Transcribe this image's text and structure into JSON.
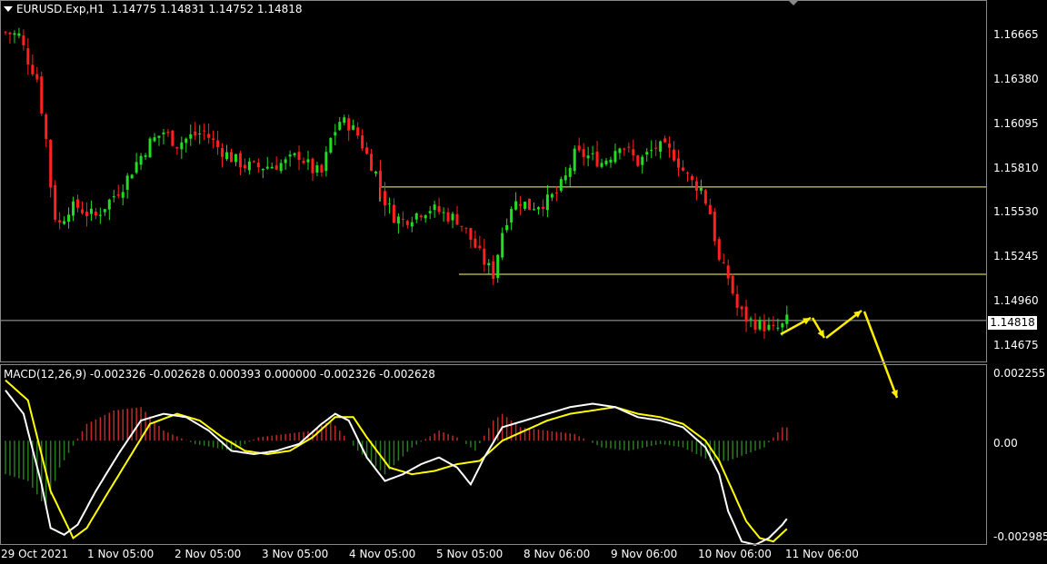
{
  "header": {
    "symbol": "EURUSD.Exp,H1",
    "ohlc": "1.14775 1.14831 1.14752 1.14818"
  },
  "macd": {
    "title": "MACD(12,26,9) -0.002326 -0.002628 0.000393 0.000000 -0.002326 -0.002628"
  },
  "price_axis": [
    "1.16665",
    "1.16380",
    "1.16095",
    "1.15810",
    "1.15530",
    "1.15245",
    "1.14960",
    "1.14675"
  ],
  "current_price": "1.14818",
  "macd_axis": [
    "0.002255",
    "0.00",
    "-0.002985"
  ],
  "time_axis": [
    "29 Oct 2021",
    "1 Nov 05:00",
    "2 Nov 05:00",
    "3 Nov 05:00",
    "4 Nov 05:00",
    "5 Nov 05:00",
    "8 Nov 06:00",
    "9 Nov 06:00",
    "10 Nov 06:00",
    "11 Nov 06:00"
  ],
  "colors": {
    "bull": "#22dd22",
    "bear": "#ff2020",
    "level_lines": "#ffff66",
    "arrows": "#ffee00",
    "macd_line": "#ffffff",
    "signal_line": "#ffff00"
  },
  "levels": {
    "resistance": 1.1569,
    "support": 1.1512,
    "current": 1.14818
  },
  "chart_data": {
    "type": "line",
    "xlabel": "",
    "ylabel": "",
    "price_range": [
      1.1455,
      1.169
    ],
    "macd_range": [
      -0.00305,
      0.00225
    ],
    "close_path": [
      [
        0,
        1.167
      ],
      [
        3,
        1.1668
      ],
      [
        5,
        1.1652
      ],
      [
        7,
        1.164
      ],
      [
        9,
        1.16
      ],
      [
        10,
        1.157
      ],
      [
        11,
        1.155
      ],
      [
        12,
        1.1545
      ],
      [
        14,
        1.1555
      ],
      [
        16,
        1.1556
      ],
      [
        18,
        1.1552
      ],
      [
        20,
        1.155
      ],
      [
        23,
        1.156
      ],
      [
        26,
        1.157
      ],
      [
        29,
        1.1585
      ],
      [
        32,
        1.1598
      ],
      [
        35,
        1.1605
      ],
      [
        38,
        1.1597
      ],
      [
        41,
        1.1602
      ],
      [
        44,
        1.1605
      ],
      [
        47,
        1.1595
      ],
      [
        50,
        1.1588
      ],
      [
        53,
        1.1583
      ],
      [
        56,
        1.1582
      ],
      [
        59,
        1.1583
      ],
      [
        62,
        1.1585
      ],
      [
        65,
        1.159
      ],
      [
        68,
        1.158
      ],
      [
        70,
        1.1578
      ],
      [
        72,
        1.16
      ],
      [
        74,
        1.1612
      ],
      [
        76,
        1.161
      ],
      [
        78,
        1.1603
      ],
      [
        80,
        1.159
      ],
      [
        82,
        1.1578
      ],
      [
        84,
        1.156
      ],
      [
        86,
        1.155
      ],
      [
        88,
        1.1547
      ],
      [
        90,
        1.155
      ],
      [
        92,
        1.1553
      ],
      [
        94,
        1.1555
      ],
      [
        96,
        1.1553
      ],
      [
        98,
        1.155
      ],
      [
        100,
        1.1548
      ],
      [
        102,
        1.154
      ],
      [
        104,
        1.153
      ],
      [
        106,
        1.152
      ],
      [
        108,
        1.1512
      ],
      [
        110,
        1.154
      ],
      [
        112,
        1.1557
      ],
      [
        114,
        1.156
      ],
      [
        116,
        1.1556
      ],
      [
        118,
        1.1558
      ],
      [
        120,
        1.156
      ],
      [
        122,
        1.1565
      ],
      [
        124,
        1.1575
      ],
      [
        126,
        1.159
      ],
      [
        128,
        1.159
      ],
      [
        130,
        1.1588
      ],
      [
        132,
        1.1585
      ],
      [
        134,
        1.159
      ],
      [
        136,
        1.1598
      ],
      [
        138,
        1.1592
      ],
      [
        140,
        1.1585
      ],
      [
        142,
        1.159
      ],
      [
        144,
        1.1595
      ],
      [
        146,
        1.1594
      ],
      [
        148,
        1.159
      ],
      [
        150,
        1.158
      ],
      [
        152,
        1.1572
      ],
      [
        154,
        1.1568
      ],
      [
        156,
        1.1552
      ],
      [
        158,
        1.152
      ],
      [
        160,
        1.151
      ],
      [
        162,
        1.149
      ],
      [
        164,
        1.1483
      ],
      [
        166,
        1.148
      ],
      [
        168,
        1.1478
      ],
      [
        170,
        1.1475
      ],
      [
        172,
        1.1478
      ],
      [
        173,
        1.14818
      ]
    ],
    "macd_line": [
      [
        0,
        0.0015
      ],
      [
        4,
        0.0008
      ],
      [
        8,
        -0.0013
      ],
      [
        10,
        -0.0026
      ],
      [
        13,
        -0.0028
      ],
      [
        16,
        -0.0025
      ],
      [
        20,
        -0.0015
      ],
      [
        25,
        -0.0004
      ],
      [
        30,
        0.0006
      ],
      [
        35,
        0.0008
      ],
      [
        40,
        0.0007
      ],
      [
        45,
        0.0003
      ],
      [
        50,
        -0.0003
      ],
      [
        55,
        -0.0004
      ],
      [
        60,
        -0.0003
      ],
      [
        65,
        -0.0001
      ],
      [
        70,
        0.0005
      ],
      [
        73,
        0.0008
      ],
      [
        76,
        0.0006
      ],
      [
        80,
        -0.0005
      ],
      [
        84,
        -0.0012
      ],
      [
        88,
        -0.001
      ],
      [
        92,
        -0.0007
      ],
      [
        96,
        -0.0005
      ],
      [
        100,
        -0.0008
      ],
      [
        103,
        -0.0013
      ],
      [
        106,
        -0.0005
      ],
      [
        110,
        0.0004
      ],
      [
        115,
        0.0006
      ],
      [
        120,
        0.0008
      ],
      [
        125,
        0.001
      ],
      [
        130,
        0.0011
      ],
      [
        135,
        0.001
      ],
      [
        140,
        0.0007
      ],
      [
        145,
        0.0006
      ],
      [
        150,
        0.0004
      ],
      [
        155,
        -0.0002
      ],
      [
        158,
        -0.001
      ],
      [
        160,
        -0.0021
      ],
      [
        163,
        -0.003
      ],
      [
        166,
        -0.0031
      ],
      [
        169,
        -0.0029
      ],
      [
        172,
        -0.0025
      ],
      [
        173,
        -0.002326
      ]
    ],
    "signal_line": [
      [
        0,
        0.0018
      ],
      [
        5,
        0.0012
      ],
      [
        10,
        -0.0015
      ],
      [
        15,
        -0.0029
      ],
      [
        18,
        -0.0026
      ],
      [
        22,
        -0.0017
      ],
      [
        27,
        -0.0006
      ],
      [
        32,
        0.0005
      ],
      [
        38,
        0.0008
      ],
      [
        43,
        0.0006
      ],
      [
        48,
        0.0001
      ],
      [
        53,
        -0.0003
      ],
      [
        58,
        -0.0004
      ],
      [
        63,
        -0.0003
      ],
      [
        68,
        0.0001
      ],
      [
        73,
        0.0007
      ],
      [
        77,
        0.0007
      ],
      [
        80,
        0.0001
      ],
      [
        85,
        -0.0008
      ],
      [
        90,
        -0.001
      ],
      [
        95,
        -0.0009
      ],
      [
        100,
        -0.0007
      ],
      [
        105,
        -0.0006
      ],
      [
        110,
        0.0
      ],
      [
        115,
        0.0003
      ],
      [
        120,
        0.0006
      ],
      [
        125,
        0.0008
      ],
      [
        130,
        0.0009
      ],
      [
        135,
        0.001
      ],
      [
        140,
        0.0008
      ],
      [
        145,
        0.0007
      ],
      [
        150,
        0.0005
      ],
      [
        155,
        0.0
      ],
      [
        158,
        -0.0006
      ],
      [
        161,
        -0.0015
      ],
      [
        164,
        -0.0024
      ],
      [
        167,
        -0.0029
      ],
      [
        170,
        -0.003
      ],
      [
        173,
        -0.002628
      ]
    ],
    "histogram_peaks": [
      [
        0,
        -0.001
      ],
      [
        5,
        -0.0012
      ],
      [
        9,
        -0.002
      ],
      [
        12,
        -0.0008
      ],
      [
        18,
        0.0005
      ],
      [
        24,
        0.0009
      ],
      [
        30,
        0.001
      ],
      [
        35,
        0.0003
      ],
      [
        42,
        -0.0001
      ],
      [
        50,
        -0.0003
      ],
      [
        56,
        0.0001
      ],
      [
        62,
        0.0002
      ],
      [
        68,
        0.0003
      ],
      [
        72,
        0.0006
      ],
      [
        78,
        -0.0003
      ],
      [
        84,
        -0.001
      ],
      [
        90,
        -0.0002
      ],
      [
        96,
        0.0003
      ],
      [
        100,
        0.0001
      ],
      [
        104,
        -0.0003
      ],
      [
        108,
        0.0006
      ],
      [
        110,
        0.0008
      ],
      [
        114,
        0.0004
      ],
      [
        120,
        0.0003
      ],
      [
        126,
        0.0002
      ],
      [
        132,
        -0.0002
      ],
      [
        138,
        -0.0003
      ],
      [
        145,
        -0.0001
      ],
      [
        150,
        -0.0002
      ],
      [
        156,
        -0.0006
      ],
      [
        160,
        -0.0006
      ],
      [
        164,
        -0.0004
      ],
      [
        168,
        -0.0002
      ],
      [
        172,
        0.0004
      ],
      [
        173,
        0.000393
      ]
    ]
  }
}
